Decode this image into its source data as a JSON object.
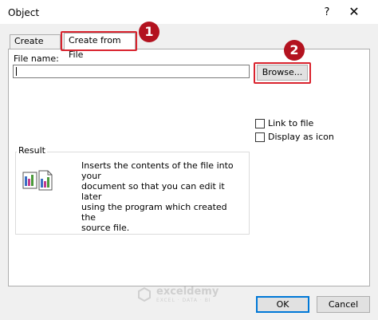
{
  "window": {
    "title": "Object",
    "help": "?",
    "close": "✕"
  },
  "tabs": [
    {
      "label": "Create New"
    },
    {
      "label": "Create from File"
    }
  ],
  "annotations": {
    "badge1": "1",
    "badge2": "2",
    "color": "#d9232e",
    "badge_color": "#b3121f"
  },
  "file": {
    "label": "File name:",
    "value": ""
  },
  "browse": {
    "label": "Browse..."
  },
  "options": {
    "link_label": "Link to file",
    "display_icon_label": "Display as icon",
    "link_checked": false,
    "display_icon_checked": false
  },
  "result": {
    "legend": "Result",
    "lines": [
      "Inserts the contents of the file into your",
      "document so that you can edit it later",
      "using the program which created the",
      "source file."
    ]
  },
  "buttons": {
    "ok": "OK",
    "cancel": "Cancel"
  },
  "watermark": {
    "name": "exceldemy",
    "tagline": "EXCEL · DATA · BI"
  },
  "icons": {
    "help": "question-icon",
    "close": "close-icon",
    "result": "document-objects-icon",
    "logo": "exceldemy-logo-icon"
  }
}
